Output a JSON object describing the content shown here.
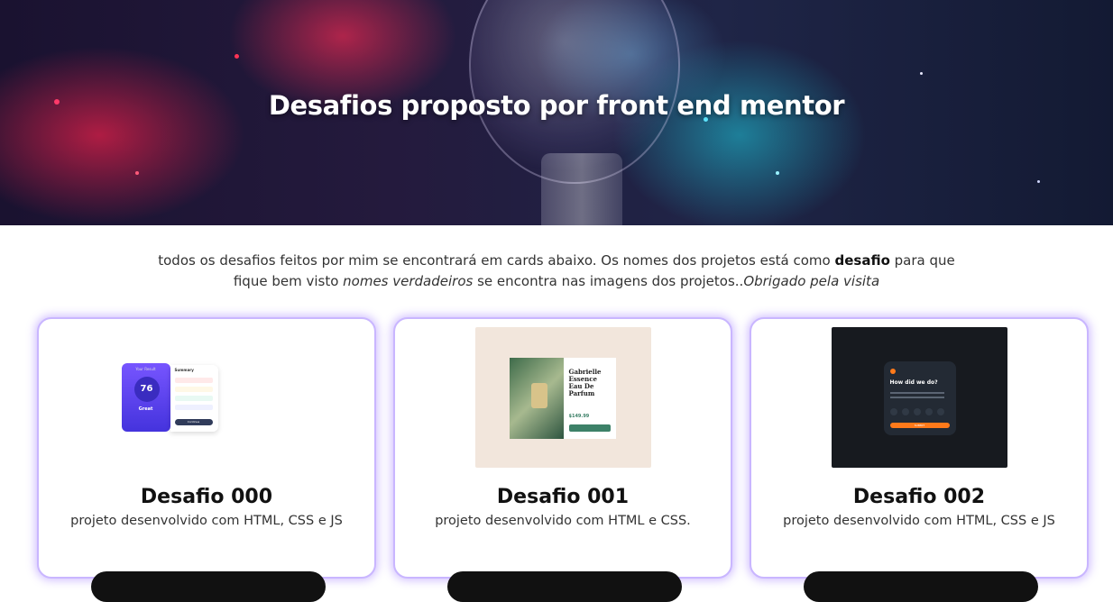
{
  "hero": {
    "title": "Desafios proposto por front end mentor"
  },
  "intro": {
    "part1": "todos os desafios feitos por mim se encontrará em cards abaixo. Os nomes dos projetos está como ",
    "bold": "desafio",
    "part2": " para que fique bem visto ",
    "italic1": "nomes verdadeiros",
    "part3": " se encontra nas imagens dos projetos..",
    "italic2": "Obrigado pela visita"
  },
  "cards": [
    {
      "title": "Desafio 000",
      "description": "projeto desenvolvido com HTML, CSS e JS",
      "thumbnail": {
        "score": "76",
        "result": "Great",
        "summary": "Summary",
        "your_result": "Your Result",
        "button": "Continue"
      }
    },
    {
      "title": "Desafio 001",
      "description": "projeto desenvolvido com HTML e CSS.",
      "thumbnail": {
        "product": "Gabrielle Essence Eau De Parfum",
        "price": "$149.99"
      }
    },
    {
      "title": "Desafio 002",
      "description": "projeto desenvolvido com HTML, CSS e JS",
      "thumbnail": {
        "question": "How did we do?",
        "button": "SUBMIT"
      }
    }
  ],
  "colors": {
    "card_border": "#c9b6ff",
    "button": "#111111"
  }
}
